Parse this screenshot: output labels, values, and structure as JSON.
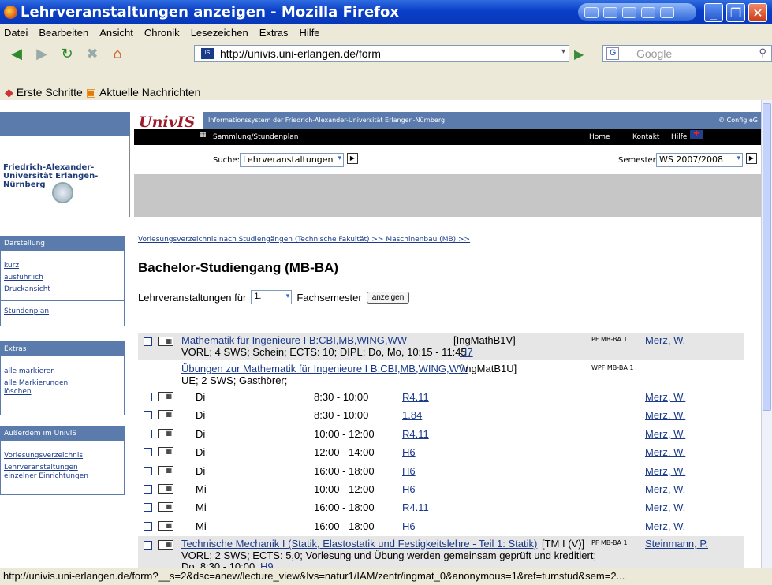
{
  "window": {
    "title": "Lehrveranstaltungen anzeigen - Mozilla Firefox"
  },
  "menu": [
    "Datei",
    "Bearbeiten",
    "Ansicht",
    "Chronik",
    "Lesezeichen",
    "Extras",
    "Hilfe"
  ],
  "address": {
    "url": "http://univis.uni-erlangen.de/form"
  },
  "search": {
    "placeholder": "Google"
  },
  "bookmarks": [
    "Erste Schritte",
    "Aktuelle Nachrichten"
  ],
  "status": "http://univis.uni-erlangen.de/form?__s=2&dsc=anew/lecture_view&lvs=natur1/IAM/zentr/ingmat_0&anonymous=1&ref=tumstud&sem=2...",
  "univis": {
    "logo": "UnivIS",
    "tagline": "Informationssystem der Friedrich-Alexander-Universität Erlangen-Nürnberg",
    "copyright": "© Config eG",
    "sammlung": "Sammlung/Stundenplan",
    "nav": [
      "Home",
      "Kontakt",
      "Hilfe"
    ],
    "search_label": "Suche:",
    "search_value": "Lehrveranstaltungen",
    "semester_label": "Semester:",
    "semester_value": "WS 2007/2008",
    "uni_name": "Friedrich-Alexander-Universität Erlangen-Nürnberg"
  },
  "sidebar": {
    "darstellung": {
      "title": "Darstellung",
      "links": [
        "kurz",
        "ausführlich",
        "Druckansicht"
      ],
      "extra": "Stundenplan"
    },
    "extras": {
      "title": "Extras",
      "links": [
        "alle markieren",
        "alle Markierungen löschen"
      ]
    },
    "ausserdem": {
      "title": "Außerdem im UnivIS",
      "links": [
        "Vorlesungsverzeichnis",
        "Lehrveranstaltungen einzelner Einrichtungen"
      ]
    }
  },
  "main": {
    "breadcrumb": "Vorlesungsverzeichnis nach Studiengängen (Technische Fakultät) >> Maschinenbau (MB) >>",
    "heading": "Bachelor-Studiengang (MB-BA)",
    "fs_label": "Lehrveranstaltungen für",
    "fs_value": "1.",
    "fs_suffix": "Fachsemester",
    "show_button": "anzeigen"
  },
  "lectures": [
    {
      "title": "Mathematik für Ingenieure I B:CBI,MB,WING,WW",
      "code": "[IngMathB1V]",
      "info": "VORL; 4 SWS; Schein; ECTS: 10; DIPL; Do, Mo, 10:15 - 11:45,",
      "room": "H7",
      "tag": "PF MB-BA 1",
      "lecturer": "Merz, W."
    },
    {
      "title": "Übungen zur Mathematik für Ingenieure I B:CBI,MB,WING,WW",
      "code": "[IngMatB1U]",
      "info": "UE; 2 SWS; Gasthörer;",
      "tag": "WPF MB-BA 1"
    },
    {
      "title": "Technische Mechanik I (Statik, Elastostatik und Festigkeitslehre - Teil 1: Statik)",
      "code": "[TM I (V)]",
      "info": "VORL; 2 SWS; ECTS: 5,0; Vorlesung und Übung werden gemeinsam geprüft und kreditiert;",
      "info2": "Do, 8:30 - 10:00,",
      "room": "H9",
      "tag": "PF MB-BA 1",
      "lecturer": "Steinmann, P."
    }
  ],
  "sessions": [
    {
      "day": "Di",
      "time": "8:30 - 10:00",
      "room": "R4.11",
      "lecturer": "Merz, W."
    },
    {
      "day": "Di",
      "time": "8:30 - 10:00",
      "room": "1.84",
      "lecturer": "Merz, W."
    },
    {
      "day": "Di",
      "time": "10:00 - 12:00",
      "room": "R4.11",
      "lecturer": "Merz, W."
    },
    {
      "day": "Di",
      "time": "12:00 - 14:00",
      "room": "H6",
      "lecturer": "Merz, W."
    },
    {
      "day": "Di",
      "time": "16:00 - 18:00",
      "room": "H6",
      "lecturer": "Merz, W."
    },
    {
      "day": "Mi",
      "time": "10:00 - 12:00",
      "room": "H6",
      "lecturer": "Merz, W."
    },
    {
      "day": "Mi",
      "time": "16:00 - 18:00",
      "room": "R4.11",
      "lecturer": "Merz, W."
    },
    {
      "day": "Mi",
      "time": "16:00 - 18:00",
      "room": "H6",
      "lecturer": "Merz, W."
    }
  ]
}
